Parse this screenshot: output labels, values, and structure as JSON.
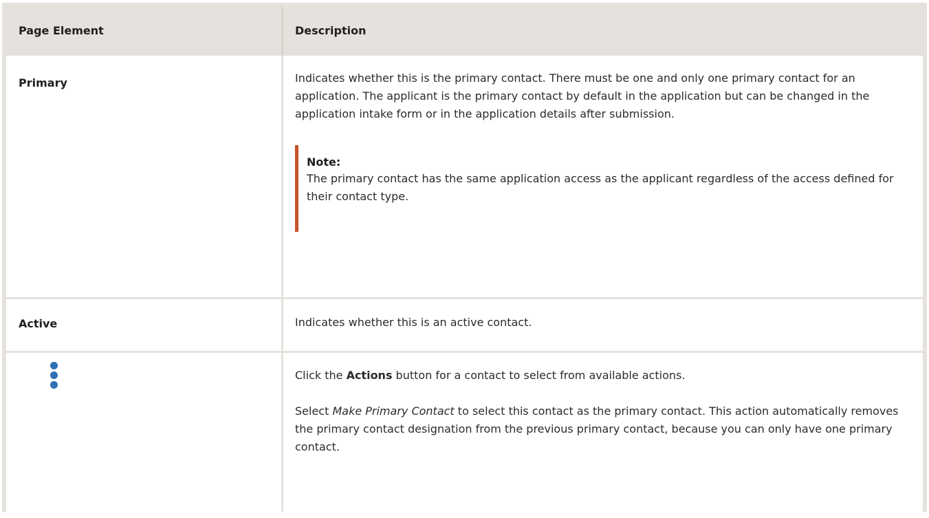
{
  "table": {
    "headers": [
      "Page Element",
      "Description"
    ],
    "rows": {
      "primary": {
        "term": "Primary",
        "description": "Indicates whether this is the primary contact. There must be one and only one primary contact for an application. The applicant is the primary contact by default in the application but can be changed in the application intake form or in the application details after submission.",
        "note": {
          "title": "Note:",
          "body": "The primary contact has the same application access as the applicant regardless of the access defined for their contact type."
        }
      },
      "active": {
        "term": "Active",
        "description": "Indicates whether this is an active contact."
      },
      "actions": {
        "icon": "actions-kebab-icon",
        "line1_before": "Click the ",
        "line1_bold": "Actions",
        "line1_after": " button for a contact to select from available actions.",
        "line2_before": "Select ",
        "line2_italic": "Make Primary Contact",
        "line2_after": " to select this contact as the primary contact. This action automatically removes the primary contact designation from the previous primary contact, because you can only have one primary contact."
      }
    }
  },
  "colors": {
    "header_bg": "#e5e2dd",
    "note_accent": "#c7522a",
    "icon_blue": "#2d71b3"
  }
}
